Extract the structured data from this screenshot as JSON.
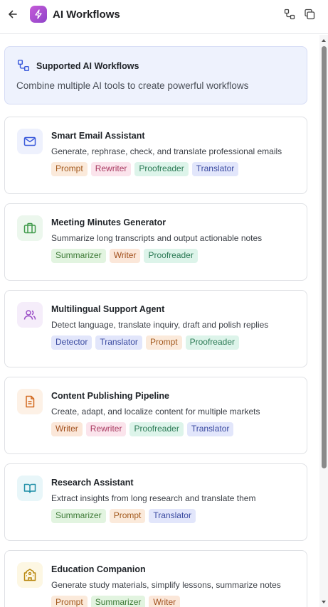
{
  "header": {
    "title": "AI Workflows",
    "back_icon": "arrow-left-icon",
    "app_icon": "lightning-bolt-icon",
    "actions": [
      "workflow-nodes-icon",
      "copy-icon"
    ]
  },
  "banner": {
    "icon": "workflow-nodes-icon",
    "title": "Supported AI Workflows",
    "subtitle": "Combine multiple AI tools to create powerful workflows"
  },
  "workflows": [
    {
      "title": "Smart Email Assistant",
      "description": "Generate, rephrase, check, and translate professional emails",
      "icon": "mail-icon",
      "icon_color": "#3b5bdb",
      "icon_bg": "#eef1fd",
      "tags": [
        {
          "label": "Prompt",
          "kind": "prompt"
        },
        {
          "label": "Rewriter",
          "kind": "rewriter"
        },
        {
          "label": "Proofreader",
          "kind": "proofreader"
        },
        {
          "label": "Translator",
          "kind": "translator"
        }
      ]
    },
    {
      "title": "Meeting Minutes Generator",
      "description": "Summarize long transcripts and output actionable notes",
      "icon": "briefcase-icon",
      "icon_color": "#3f9a4a",
      "icon_bg": "#ecf7ed",
      "tags": [
        {
          "label": "Summarizer",
          "kind": "summarizer"
        },
        {
          "label": "Writer",
          "kind": "writer"
        },
        {
          "label": "Proofreader",
          "kind": "proofreader"
        }
      ]
    },
    {
      "title": "Multilingual Support Agent",
      "description": "Detect language, translate inquiry, draft and polish replies",
      "icon": "users-icon",
      "icon_color": "#9b4fc7",
      "icon_bg": "#f5edfa",
      "tags": [
        {
          "label": "Detector",
          "kind": "detector"
        },
        {
          "label": "Translator",
          "kind": "translator"
        },
        {
          "label": "Prompt",
          "kind": "prompt"
        },
        {
          "label": "Proofreader",
          "kind": "proofreader"
        }
      ]
    },
    {
      "title": "Content Publishing Pipeline",
      "description": "Create, adapt, and localize content for multiple markets",
      "icon": "document-icon",
      "icon_color": "#d2691e",
      "icon_bg": "#fdf1e6",
      "tags": [
        {
          "label": "Writer",
          "kind": "writer"
        },
        {
          "label": "Rewriter",
          "kind": "rewriter"
        },
        {
          "label": "Proofreader",
          "kind": "proofreader"
        },
        {
          "label": "Translator",
          "kind": "translator"
        }
      ]
    },
    {
      "title": "Research Assistant",
      "description": "Extract insights from long research and translate them",
      "icon": "open-book-icon",
      "icon_color": "#1f8fa8",
      "icon_bg": "#e8f6f9",
      "tags": [
        {
          "label": "Summarizer",
          "kind": "summarizer"
        },
        {
          "label": "Prompt",
          "kind": "prompt"
        },
        {
          "label": "Translator",
          "kind": "translator"
        }
      ]
    },
    {
      "title": "Education Companion",
      "description": "Generate study materials, simplify lessons, summarize notes",
      "icon": "school-icon",
      "icon_color": "#b8860b",
      "icon_bg": "#fdf7e3",
      "tags": [
        {
          "label": "Prompt",
          "kind": "prompt"
        },
        {
          "label": "Summarizer",
          "kind": "summarizer"
        },
        {
          "label": "Writer",
          "kind": "writer"
        }
      ]
    }
  ]
}
